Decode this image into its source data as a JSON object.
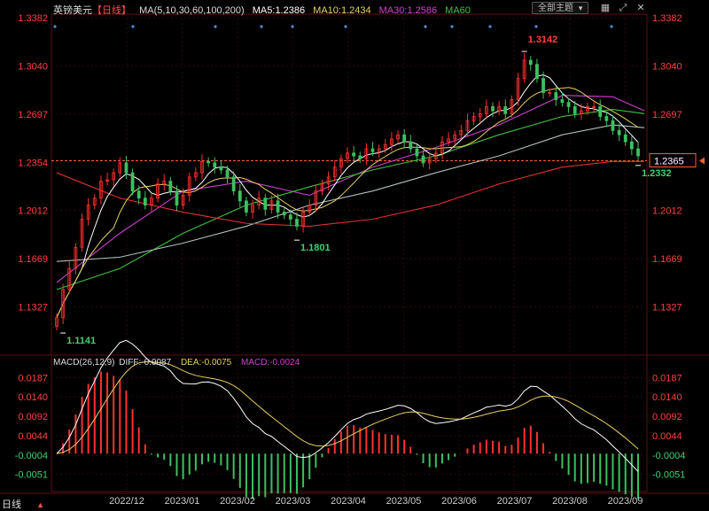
{
  "header": {
    "symbol": "英镑美元",
    "period_bracket": "【日线】",
    "ma_label": "MA(5,10,30,60,100,200)",
    "ma5": "MA5:1.2386",
    "ma10": "MA10:1.2434",
    "ma30": "MA30:1.2586",
    "ma60": "MA60",
    "theme_button": "全部主题",
    "theme_arrow": "▼",
    "tool_icons": [
      "grid-icon",
      "expand-icon",
      "close-icon"
    ]
  },
  "macd": {
    "title": "MACD(26,12,9)",
    "diff": "DIFF:-0.0087",
    "dea": "DEA:-0.0075",
    "macd": "MACD:-0.0024"
  },
  "footer": {
    "period": "日线",
    "arrow": "▲"
  },
  "colors": {
    "up": "#ff3030",
    "down": "#3cc060",
    "ma5": "#ffffff",
    "ma10": "#e8d060",
    "ma30": "#d040d0",
    "ma60": "#40c040",
    "ma100": "#b0c0c0",
    "ma200": "#e03030",
    "diff": "#ffffff",
    "dea": "#e8d060",
    "label_red": "#ff4040",
    "label_green": "#40d070"
  },
  "chart_data": {
    "type": "candlestick",
    "x_ticks": [
      "2022/12",
      "2023/01",
      "2023/02",
      "2023/03",
      "2023/04",
      "2023/05",
      "2023/06",
      "2023/07",
      "2023/08",
      "2023/09"
    ],
    "price_axis": {
      "ticks": [
        "1.3382",
        "1.3040",
        "1.2697",
        "1.2354",
        "1.2012",
        "1.1669",
        "1.1327"
      ],
      "range": [
        1.1141,
        1.3382
      ]
    },
    "current_price": "1.2365",
    "annotations": [
      {
        "label": "1.3142",
        "x_index": 74,
        "y": 1.3142,
        "kind": "high"
      },
      {
        "label": "1.1801",
        "x_index": 38,
        "y": 1.1801,
        "kind": "low"
      },
      {
        "label": "1.1141",
        "x_index": 1,
        "y": 1.1141,
        "kind": "low"
      },
      {
        "label": "1.2332",
        "x_index": 92,
        "y": 1.2332,
        "kind": "low"
      }
    ],
    "closes": [
      1.125,
      1.145,
      1.16,
      1.175,
      1.195,
      1.205,
      1.21,
      1.222,
      1.223,
      1.228,
      1.235,
      1.228,
      1.215,
      1.21,
      1.205,
      1.21,
      1.22,
      1.222,
      1.215,
      1.205,
      1.212,
      1.225,
      1.228,
      1.236,
      1.235,
      1.232,
      1.23,
      1.225,
      1.215,
      1.208,
      1.2,
      1.205,
      1.21,
      1.202,
      1.208,
      1.2,
      1.198,
      1.195,
      1.19,
      1.2,
      1.205,
      1.215,
      1.22,
      1.225,
      1.232,
      1.238,
      1.242,
      1.24,
      1.238,
      1.245,
      1.243,
      1.245,
      1.248,
      1.252,
      1.255,
      1.25,
      1.245,
      1.24,
      1.235,
      1.238,
      1.242,
      1.25,
      1.252,
      1.255,
      1.258,
      1.265,
      1.268,
      1.27,
      1.275,
      1.272,
      1.275,
      1.27,
      1.28,
      1.295,
      1.308,
      1.305,
      1.295,
      1.285,
      1.285,
      1.28,
      1.278,
      1.275,
      1.27,
      1.272,
      1.275,
      1.275,
      1.268,
      1.265,
      1.258,
      1.255,
      1.25,
      1.245,
      1.24
    ],
    "ma_series": {
      "MA30": [
        [
          0,
          1.15
        ],
        [
          10,
          1.185
        ],
        [
          20,
          1.215
        ],
        [
          30,
          1.222
        ],
        [
          40,
          1.212
        ],
        [
          50,
          1.232
        ],
        [
          60,
          1.246
        ],
        [
          70,
          1.262
        ],
        [
          80,
          1.283
        ],
        [
          88,
          1.282
        ],
        [
          93,
          1.272
        ]
      ],
      "MA60": [
        [
          0,
          1.145
        ],
        [
          10,
          1.16
        ],
        [
          20,
          1.185
        ],
        [
          30,
          1.205
        ],
        [
          40,
          1.218
        ],
        [
          50,
          1.23
        ],
        [
          60,
          1.24
        ],
        [
          70,
          1.255
        ],
        [
          80,
          1.268
        ],
        [
          88,
          1.273
        ],
        [
          93,
          1.27
        ]
      ],
      "MA100": [
        [
          0,
          1.165
        ],
        [
          10,
          1.168
        ],
        [
          20,
          1.178
        ],
        [
          30,
          1.19
        ],
        [
          40,
          1.205
        ],
        [
          50,
          1.215
        ],
        [
          60,
          1.228
        ],
        [
          70,
          1.24
        ],
        [
          80,
          1.255
        ],
        [
          88,
          1.262
        ],
        [
          93,
          1.26
        ]
      ],
      "MA200": [
        [
          0,
          1.228
        ],
        [
          10,
          1.21
        ],
        [
          20,
          1.2
        ],
        [
          30,
          1.192
        ],
        [
          40,
          1.19
        ],
        [
          50,
          1.195
        ],
        [
          60,
          1.205
        ],
        [
          70,
          1.22
        ],
        [
          80,
          1.232
        ],
        [
          88,
          1.236
        ],
        [
          93,
          1.236
        ]
      ]
    },
    "macd_axis": {
      "ticks": [
        "0.0187",
        "0.0140",
        "0.0092",
        "0.0044",
        "-0.0004",
        "-0.0051"
      ],
      "range": [
        -0.008,
        0.0205
      ]
    }
  }
}
